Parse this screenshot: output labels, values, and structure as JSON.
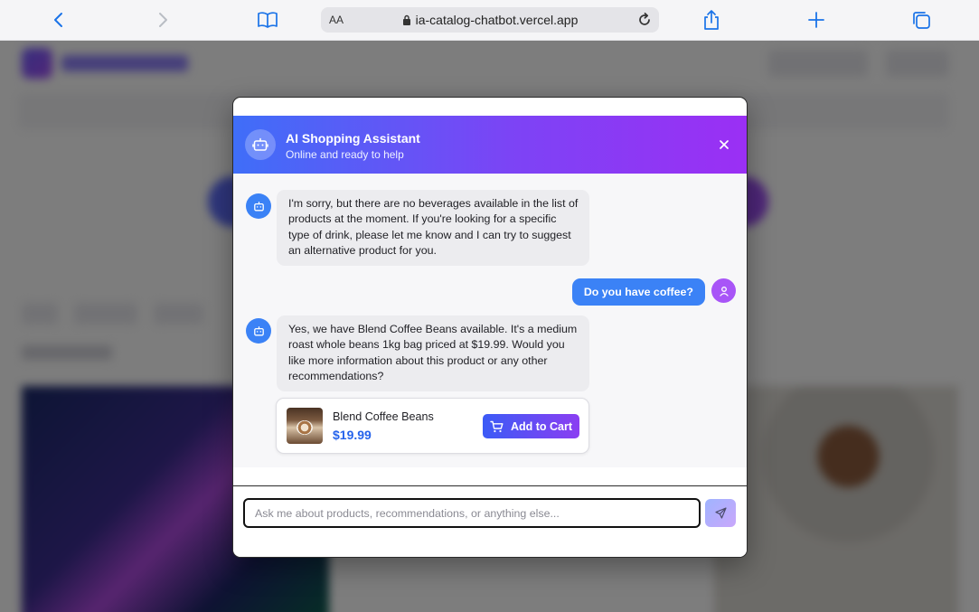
{
  "browser": {
    "text_size_label": "AA",
    "url": "ia-catalog-chatbot.vercel.app",
    "accent_color": "#1a73e8"
  },
  "chat": {
    "title": "AI Shopping Assistant",
    "subtitle": "Online and ready to help",
    "header_gradient": [
      "#3f6ef8",
      "#9b2ff4"
    ],
    "messages": [
      {
        "role": "bot",
        "text": "I'm sorry, but there are no beverages available in the list of products at the moment. If you're looking for a specific type of drink, please let me know and I can try to suggest an alternative product for you."
      },
      {
        "role": "user",
        "text": "Do you have coffee?"
      },
      {
        "role": "bot",
        "text": "Yes, we have Blend Coffee Beans available. It's a medium roast whole beans 1kg bag priced at $19.99. Would you like more information about this product or any other recommendations?"
      }
    ],
    "product": {
      "name": "Blend Coffee Beans",
      "price": "$19.99",
      "button_label": "Add to Cart"
    },
    "input": {
      "placeholder": "Ask me about products, recommendations, or anything else...",
      "value": ""
    }
  }
}
